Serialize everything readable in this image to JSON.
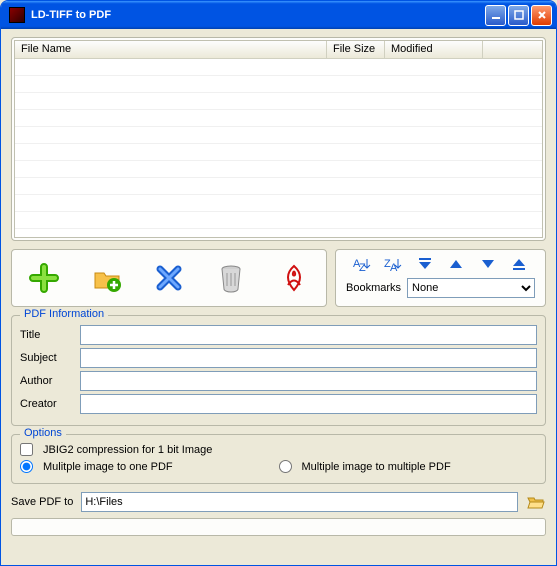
{
  "window": {
    "title": "LD-TIFF to PDF"
  },
  "list": {
    "columns": {
      "filename": "File Name",
      "filesize": "File Size",
      "modified": "Modified"
    }
  },
  "bookmarks": {
    "label": "Bookmarks",
    "selected": "None",
    "options": [
      "None"
    ]
  },
  "pdfinfo": {
    "legend": "PDF Information",
    "title_label": "Title",
    "title": "",
    "subject_label": "Subject",
    "subject": "",
    "author_label": "Author",
    "author": "",
    "creator_label": "Creator",
    "creator": ""
  },
  "options": {
    "legend": "Options",
    "jbig2_label": "JBIG2 compression for 1 bit Image",
    "jbig2_checked": false,
    "multi_one_label": "Mulitple image to one PDF",
    "multi_multi_label": "Multiple image to multiple PDF",
    "mode": "one"
  },
  "save": {
    "label": "Save PDF to",
    "path": "H:\\Files"
  }
}
